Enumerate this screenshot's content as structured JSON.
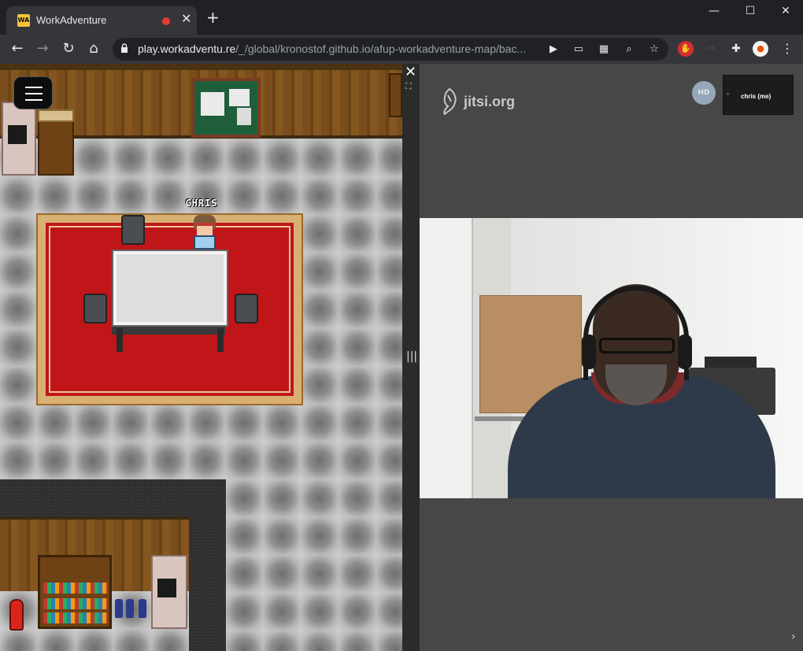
{
  "browser": {
    "tab": {
      "favicon": "WA",
      "title": "WorkAdventure"
    },
    "new_tab_label": "+",
    "window_controls": {
      "minimize": "—",
      "maximize": "☐",
      "close": "✕"
    },
    "nav": {
      "back": "←",
      "forward": "→",
      "reload": "↻",
      "home": "⌂"
    },
    "url": {
      "host": "play.workadventu.re",
      "path": "/_/global/kronostof.github.io/afup-workadventure-map/bac..."
    },
    "omnibox_icons": [
      "camera-icon",
      "cast-icon",
      "qr-code-icon",
      "zoom-icon",
      "star-icon"
    ],
    "extensions": [
      "adblock-icon",
      "extension-icon",
      "puzzle-icon",
      "profile-avatar"
    ],
    "menu": "⋮"
  },
  "game": {
    "player_name": "CHRIS",
    "menu_icon": "hamburger-icon"
  },
  "panel": {
    "close": "✕",
    "expand": "⛶",
    "grip": "|||"
  },
  "jitsi": {
    "logo": "jitsi.org",
    "avatar_initials": "HD",
    "self_label": "chris (me)",
    "collapse": "›"
  },
  "colors": {
    "browser_bg": "#202124",
    "tab_bg": "#35363a",
    "rug": "#c0161a",
    "jitsi_bg": "#474747",
    "recording": "#e53935"
  }
}
